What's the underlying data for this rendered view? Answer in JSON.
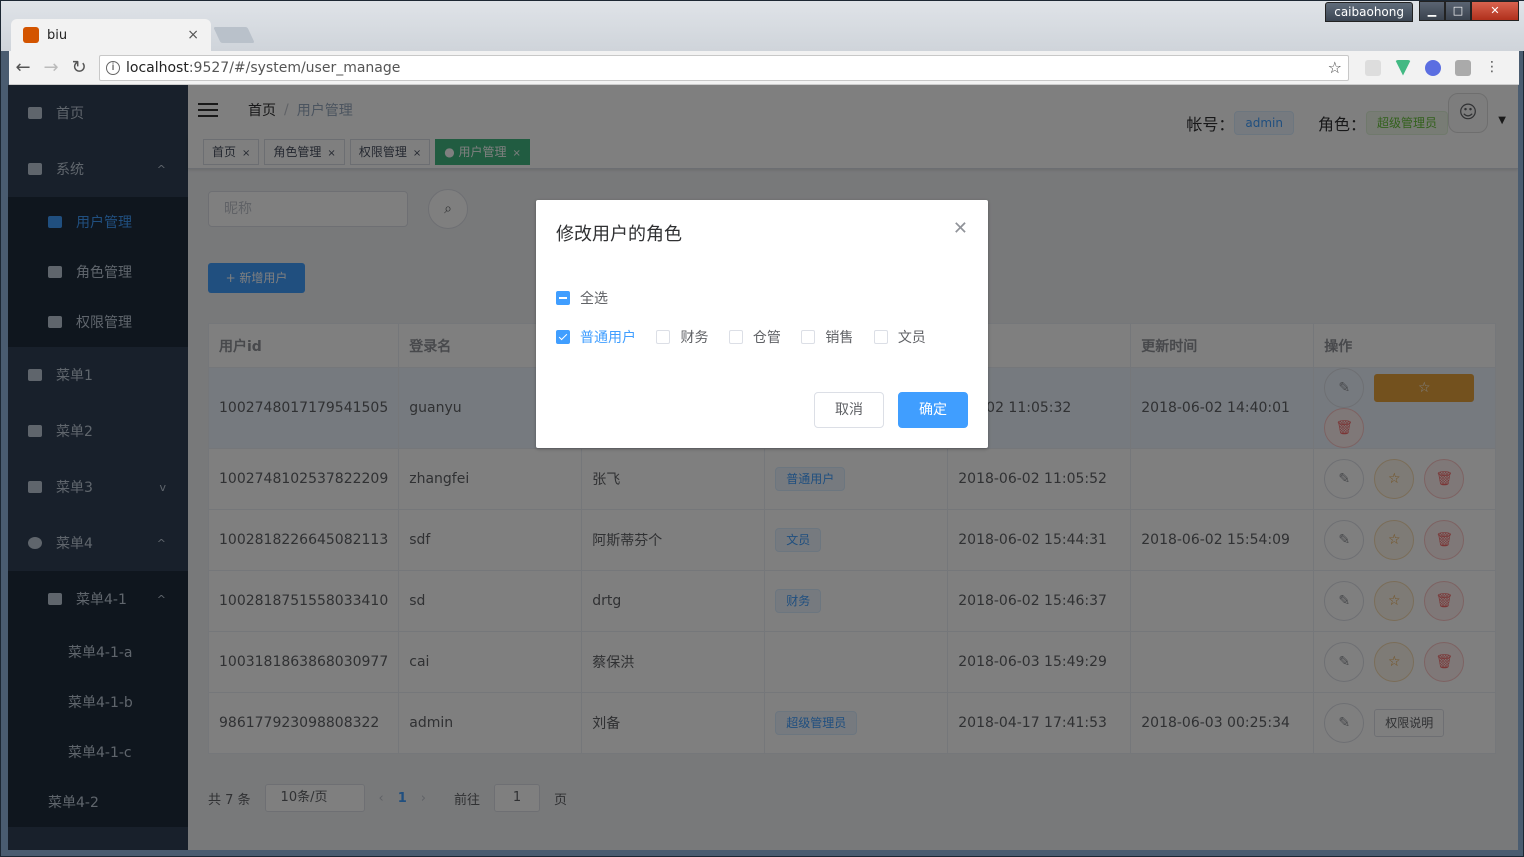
{
  "browser": {
    "tab_title": "biu",
    "tab_close": "×",
    "url": "localhost:9527/#/system/user_manage",
    "url_host": "localhost",
    "url_rest": ":9527/#/system/user_manage",
    "profile": "caibaohong",
    "controls": {
      "min": "▁",
      "max": "□",
      "close": "✕"
    }
  },
  "sidebar": {
    "items": [
      {
        "label": "首页",
        "icon": "dashboard-icon"
      },
      {
        "label": "系统",
        "icon": "chart-icon",
        "arrow": "^"
      },
      {
        "label": "用户管理",
        "icon": "chart-icon"
      },
      {
        "label": "角色管理",
        "icon": "chart-icon"
      },
      {
        "label": "权限管理",
        "icon": "chart-icon"
      },
      {
        "label": "菜单1",
        "icon": "info-icon"
      },
      {
        "label": "菜单2",
        "icon": "info-icon"
      },
      {
        "label": "菜单3",
        "icon": "chart-icon",
        "arrow": "v"
      },
      {
        "label": "菜单4",
        "icon": "bug-icon",
        "arrow": "^"
      },
      {
        "label": "菜单4-1",
        "icon": "table-icon",
        "arrow": "^"
      },
      {
        "label": "菜单4-1-a"
      },
      {
        "label": "菜单4-1-b"
      },
      {
        "label": "菜单4-1-c"
      },
      {
        "label": "菜单4-2"
      }
    ]
  },
  "navbar": {
    "breadcrumb": [
      "首页",
      "用户管理"
    ],
    "breadcrumb_sep": "/",
    "account_label": "帐号：",
    "account_value": "admin",
    "role_label": "角色：",
    "role_value": "超级管理员"
  },
  "tags_view": [
    {
      "label": "首页",
      "close": "×"
    },
    {
      "label": "角色管理",
      "close": "×"
    },
    {
      "label": "权限管理",
      "close": "×"
    },
    {
      "label": "● 用户管理",
      "close": "×"
    }
  ],
  "search": {
    "placeholder": "昵称"
  },
  "add_button": "+ 新增用户",
  "table": {
    "headers": [
      "用户id",
      "登录名",
      "",
      "",
      "时间",
      "更新时间",
      "操作"
    ],
    "rows": [
      {
        "id": "1002748017179541505",
        "login": "guanyu",
        "nick": "",
        "role": "",
        "created": "-06-02 11:05:32",
        "updated": "2018-06-02 14:40:01"
      },
      {
        "id": "1002748102537822209",
        "login": "zhangfei",
        "nick": "张飞",
        "role": "普通用户",
        "created": "2018-06-02 11:05:52",
        "updated": ""
      },
      {
        "id": "1002818226645082113",
        "login": "sdf",
        "nick": "阿斯蒂芬个",
        "role": "文员",
        "created": "2018-06-02 15:44:31",
        "updated": "2018-06-02 15:54:09"
      },
      {
        "id": "1002818751558033410",
        "login": "sd",
        "nick": "drtg",
        "role": "财务",
        "created": "2018-06-02 15:46:37",
        "updated": ""
      },
      {
        "id": "1003181863868030977",
        "login": "cai",
        "nick": "蔡保洪",
        "role": "",
        "created": "2018-06-03 15:49:29",
        "updated": ""
      },
      {
        "id": "986177923098808322",
        "login": "admin",
        "nick": "刘备",
        "role": "超级管理员",
        "created": "2018-04-17 17:41:53",
        "updated": "2018-06-03 00:25:34"
      }
    ],
    "perm_button": "权限说明"
  },
  "pager": {
    "total": "共 7 条",
    "size": "10条/页",
    "page": "1",
    "goto": "前往",
    "goto_value": "1",
    "page_unit": "页"
  },
  "dialog": {
    "title": "修改用户的角色",
    "select_all": "全选",
    "options": [
      "普通用户",
      "财务",
      "仓管",
      "销售",
      "文员"
    ],
    "cancel": "取消",
    "confirm": "确定"
  },
  "colors": {
    "primary": "#409eff",
    "sidebar": "#304156",
    "warning": "#e6a23c",
    "danger": "#f56c6c"
  }
}
